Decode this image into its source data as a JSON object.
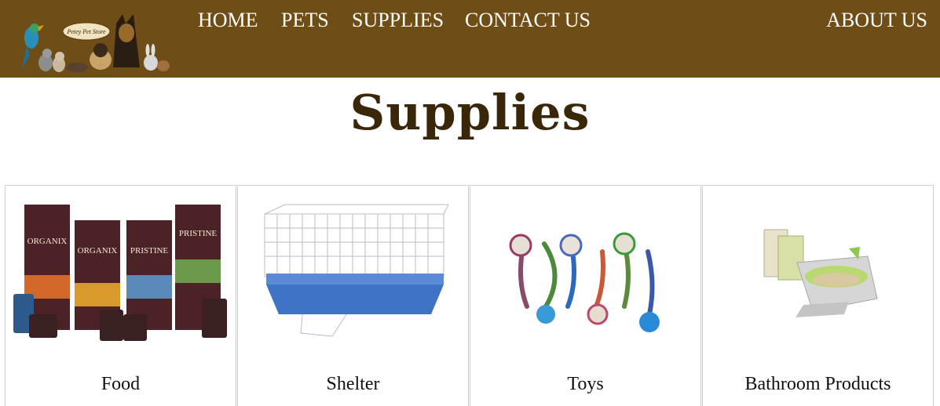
{
  "header": {
    "logo_text": "Petey Pet Store",
    "nav": {
      "home": "HOME",
      "pets": "PETS",
      "supplies": "SUPPLIES",
      "contact": "CONTACT US",
      "about": "ABOUT US"
    },
    "background": "#6e4d17"
  },
  "main": {
    "title": "Supplies",
    "title_color": "#3a2709",
    "categories": [
      {
        "label": "Food",
        "image": "pet-food-bags-and-cans"
      },
      {
        "label": "Shelter",
        "image": "wire-pet-cage"
      },
      {
        "label": "Toys",
        "image": "rope-and-ball-dog-toys"
      },
      {
        "label": "Bathroom Products",
        "image": "cat-litter-box-and-pellets"
      }
    ]
  }
}
